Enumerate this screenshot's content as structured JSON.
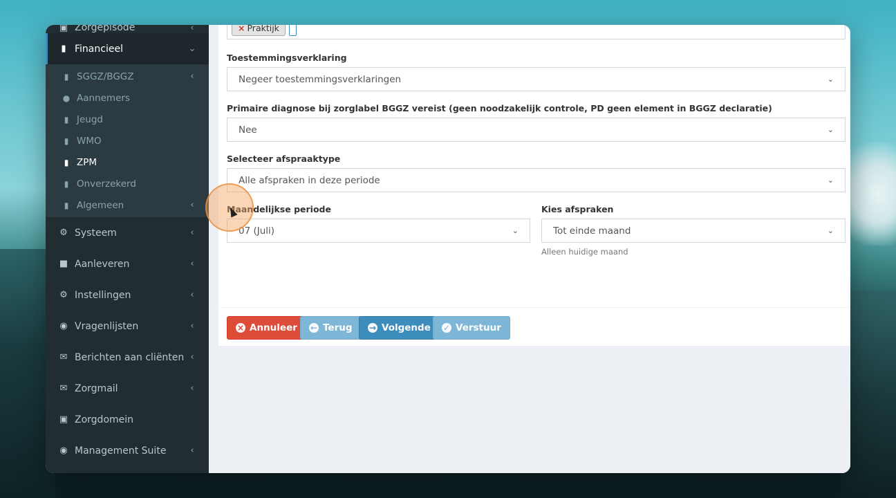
{
  "sidebar": {
    "items_top": [
      {
        "label": "Zorgepisode",
        "icon": "medkit-icon"
      },
      {
        "label": "Financieel",
        "icon": "book-icon"
      }
    ],
    "financieel_sub": [
      {
        "label": "SGGZ/BGGZ",
        "icon": "book-icon",
        "has_chevron": true
      },
      {
        "label": "Aannemers",
        "icon": "users-icon",
        "has_chevron": false
      },
      {
        "label": "Jeugd",
        "icon": "book-icon",
        "has_chevron": false
      },
      {
        "label": "WMO",
        "icon": "book-icon",
        "has_chevron": false
      },
      {
        "label": "ZPM",
        "icon": "book-icon",
        "has_chevron": false
      },
      {
        "label": "Onverzekerd",
        "icon": "book-icon",
        "has_chevron": false
      },
      {
        "label": "Algemeen",
        "icon": "book-icon",
        "has_chevron": true
      }
    ],
    "items_bottom": [
      {
        "label": "Systeem",
        "icon": "cogs-icon"
      },
      {
        "label": "Aanleveren",
        "icon": "truck-icon"
      },
      {
        "label": "Instellingen",
        "icon": "gear-icon"
      },
      {
        "label": "Vragenlijsten",
        "icon": "globe-icon"
      },
      {
        "label": "Berichten aan cliënten",
        "icon": "envelope-icon"
      },
      {
        "label": "Zorgmail",
        "icon": "envelope-icon"
      },
      {
        "label": "Zorgdomein",
        "icon": "inbox-icon"
      },
      {
        "label": "Management Suite",
        "icon": "globe-icon"
      }
    ]
  },
  "form": {
    "tag_label": "Praktijk",
    "toestemming": {
      "label": "Toestemmingsverklaring",
      "value": "Negeer toestemmingsverklaringen"
    },
    "diagnose": {
      "label": "Primaire diagnose bij zorglabel BGGZ vereist (geen noodzakelijk controle, PD geen element in BGGZ declaratie)",
      "value": "Nee"
    },
    "afspraaktype": {
      "label": "Selecteer afspraaktype",
      "value": "Alle afspraken in deze periode"
    },
    "periode": {
      "label": "Maandelijkse periode",
      "value": "07 (Juli)"
    },
    "kies": {
      "label": "Kies afspraken",
      "value": "Tot einde maand",
      "help": "Alleen huidige maand"
    }
  },
  "buttons": {
    "cancel": "Annuleer",
    "back": "Terug",
    "next": "Volgende",
    "send": "Verstuur"
  },
  "colors": {
    "sidebar_bg": "#222d32",
    "sidebar_sub_bg": "#2c3b41",
    "accent": "#3c8dbc",
    "danger": "#dd4b39",
    "light_primary": "#7eb6d8"
  }
}
